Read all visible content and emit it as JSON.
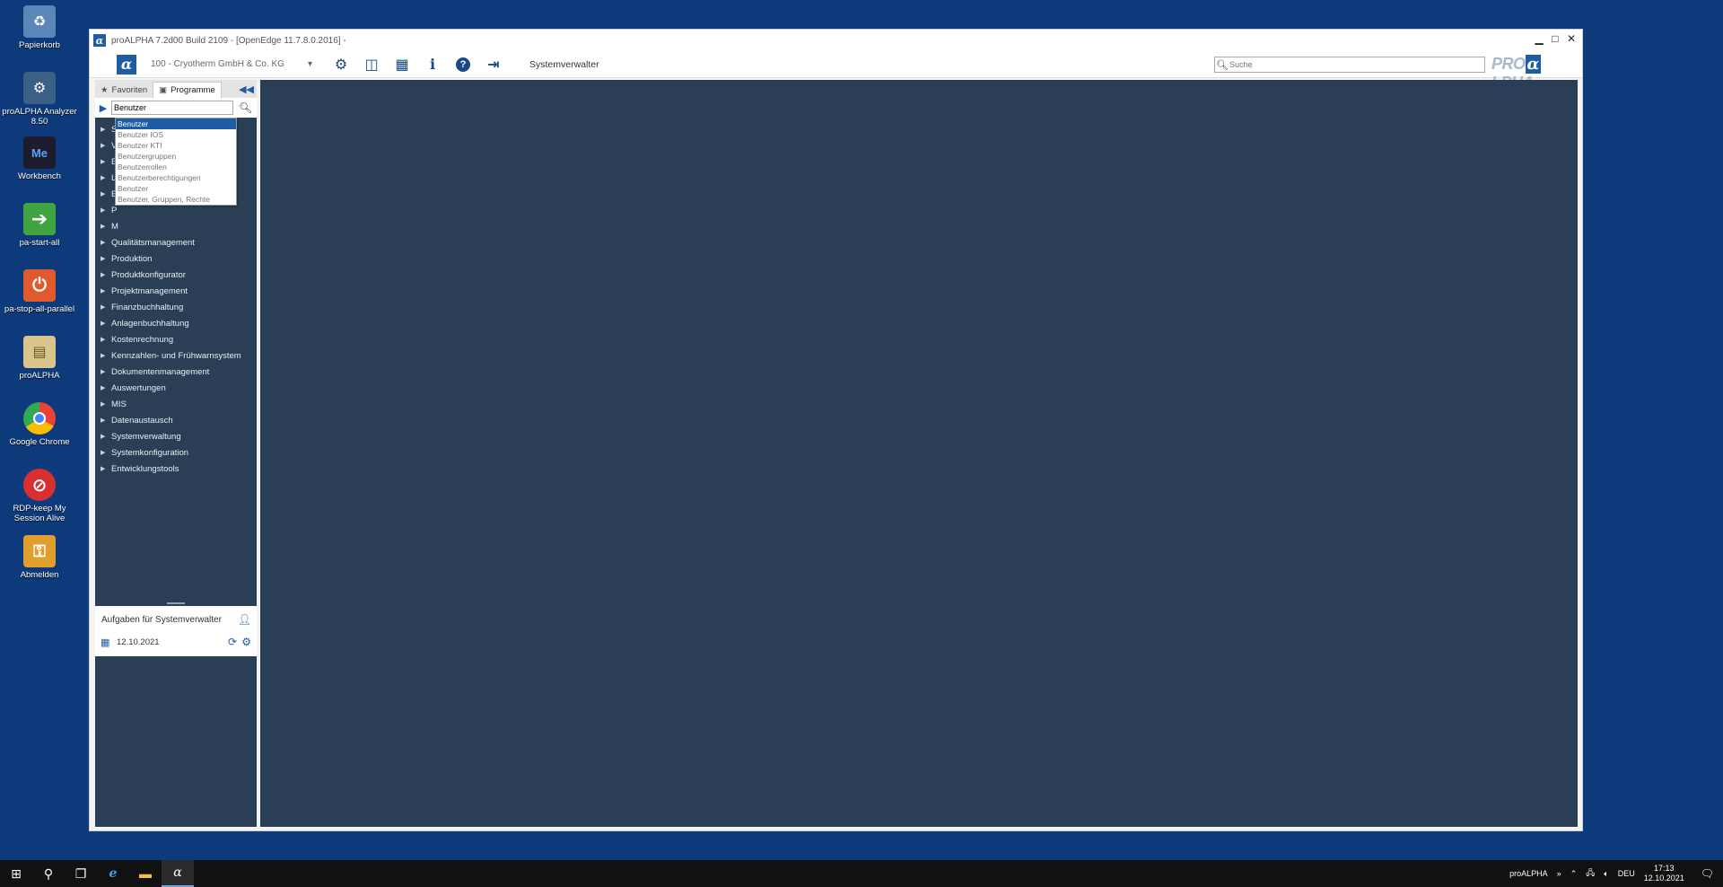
{
  "desktop": {
    "icons": [
      {
        "label": "Papierkorb",
        "icon": "recycle-bin-icon",
        "color": "#5b86b8"
      },
      {
        "label": "proALPHA Analyzer 8.50",
        "icon": "analyzer-icon",
        "color": "#3c5f85"
      },
      {
        "label": "Workbench",
        "icon": "workbench-icon",
        "color": "#1c1c2c"
      },
      {
        "label": "pa-start-all",
        "icon": "start-arrow-icon",
        "color": "#3fa33f"
      },
      {
        "label": "pa-stop-all-parallel",
        "icon": "stop-power-icon",
        "color": "#e05a2e"
      },
      {
        "label": "proALPHA",
        "icon": "document-icon",
        "color": "#d9c48c"
      },
      {
        "label": "Google Chrome",
        "icon": "chrome-icon",
        "color": "#ea4335"
      },
      {
        "label": "RDP-keep My Session Alive",
        "icon": "no-entry-icon",
        "color": "#d83030"
      },
      {
        "label": "Abmelden",
        "icon": "key-icon",
        "color": "#e0a030"
      }
    ]
  },
  "window": {
    "title": "proALPHA 7.2d00 Build 2109 - [OpenEdge 11.7.8.0.2016] -",
    "minimize": "▁",
    "maximize": "□",
    "close": "✕"
  },
  "toolbar": {
    "alpha": "α",
    "company": "100 - Cryotherm GmbH & Co. KG",
    "company_arrow": "▾",
    "user": "Systemverwalter",
    "search_placeholder": "Suche",
    "brand_pre": "PRO",
    "brand_alpha": "α",
    "brand_post": "LPHA"
  },
  "nav": {
    "tab_favorites": "Favoriten",
    "tab_programs": "Programme",
    "search_value": "Benutzer",
    "dropdown": [
      "Benutzer",
      "Benutzer IOS",
      "Benutzer KTI",
      "Benutzergruppen",
      "Benutzerrollen",
      "Benutzerberechtigungen",
      "Benutzer",
      "Benutzer, Gruppen, Rechte"
    ],
    "tree": [
      "S",
      "V",
      "E",
      "L",
      "B",
      "P",
      "M",
      "Qualitätsmanagement",
      "Produktion",
      "Produktkonfigurator",
      "Projektmanagement",
      "Finanzbuchhaltung",
      "Anlagenbuchhaltung",
      "Kostenrechnung",
      "Kennzahlen- und Frühwarnsystem",
      "Dokumentenmanagement",
      "Auswertungen",
      "MIS",
      "Datenaustausch",
      "Systemverwaltung",
      "Systemkonfiguration",
      "Entwicklungstools"
    ]
  },
  "tasks": {
    "title": "Aufgaben für Systemverwalter",
    "date": "12.10.2021"
  },
  "taskbar": {
    "app_label": "proALPHA",
    "chevron": "»",
    "language": "DEU",
    "time": "17:13",
    "date": "12.10.2021"
  },
  "colors": {
    "desktop_bg": "#0d3a7a",
    "panel_bg": "#2a3f55",
    "accent": "#1f5ca6"
  }
}
